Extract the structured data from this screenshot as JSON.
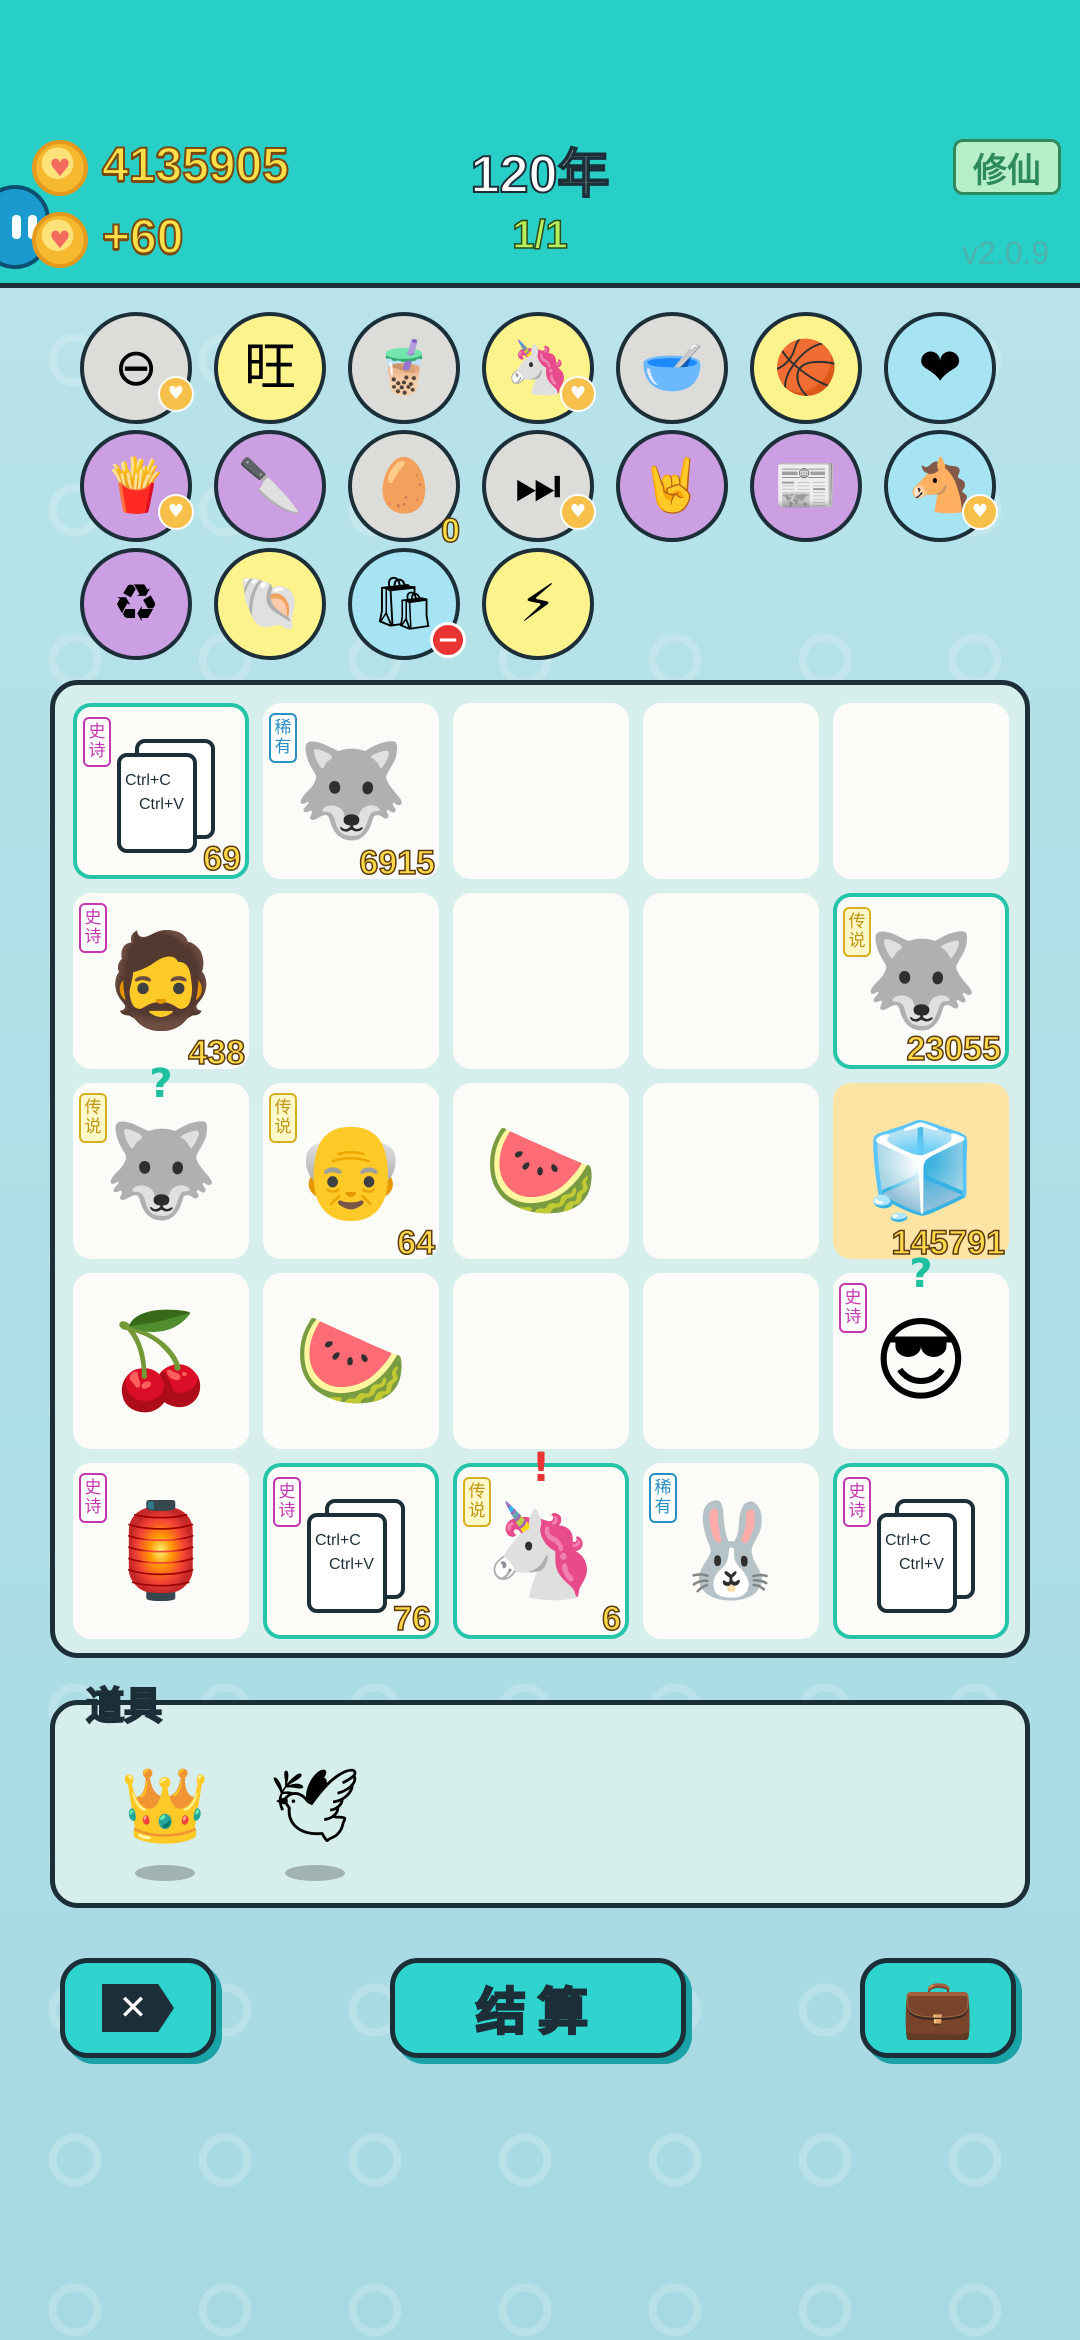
{
  "header": {
    "coins": "4135905",
    "income": "+60",
    "year": "120年",
    "progress": "1/1",
    "xiuxian_label": "修仙",
    "version": "v2.0.9"
  },
  "items": [
    {
      "icon": "no-entry-icon",
      "glyph": "⊖",
      "badge": "heart"
    },
    {
      "icon": "wang-dice-icon",
      "glyph": "旺",
      "badge": ""
    },
    {
      "icon": "bubble-tea-icon",
      "glyph": "🧋",
      "badge": ""
    },
    {
      "icon": "unicorn-icon",
      "glyph": "🦄",
      "badge": "heart"
    },
    {
      "icon": "dog-bowl-icon",
      "glyph": "🥣",
      "badge": ""
    },
    {
      "icon": "basketballs-icon",
      "glyph": "🏀",
      "badge": ""
    },
    {
      "icon": "heart-blood-bag-icon",
      "glyph": "❤",
      "badge": ""
    },
    {
      "icon": "french-fries-icon",
      "glyph": "🍟",
      "badge": "heart"
    },
    {
      "icon": "cleaver-icon",
      "glyph": "🔪",
      "badge": ""
    },
    {
      "icon": "egg-tray-icon",
      "glyph": "🥚",
      "badge": "",
      "count": "0"
    },
    {
      "icon": "skip-icon",
      "glyph": "⏭",
      "badge": "heart"
    },
    {
      "icon": "rock-hand-icon",
      "glyph": "🤘",
      "badge": ""
    },
    {
      "icon": "time-magazine-icon",
      "glyph": "📰",
      "badge": ""
    },
    {
      "icon": "twin-unicorns-icon",
      "glyph": "🐴",
      "badge": "heart"
    },
    {
      "icon": "recycle-icon",
      "glyph": "♻",
      "badge": ""
    },
    {
      "icon": "shell-icon",
      "glyph": "🐚",
      "badge": ""
    },
    {
      "icon": "trash-bag-icon",
      "glyph": "🛍",
      "badge": "remove"
    },
    {
      "icon": "lightning-icon",
      "glyph": "⚡",
      "badge": ""
    }
  ],
  "board": [
    {
      "name": "copy-paste-card",
      "glyph": "",
      "card": true,
      "card_text1": "Ctrl+C",
      "card_text2": "Ctrl+V",
      "rarity": "史诗",
      "rclass": "epic",
      "count": "69",
      "hl": true
    },
    {
      "name": "husky",
      "glyph": "🐺",
      "rarity": "稀有",
      "rclass": "rare",
      "count": "6915"
    },
    {
      "name": "empty",
      "glyph": ""
    },
    {
      "name": "empty",
      "glyph": ""
    },
    {
      "name": "empty",
      "glyph": ""
    },
    {
      "name": "bearded-old-man",
      "glyph": "🧔",
      "rarity": "史诗",
      "rclass": "epic",
      "count": "438"
    },
    {
      "name": "empty",
      "glyph": ""
    },
    {
      "name": "empty",
      "glyph": ""
    },
    {
      "name": "empty",
      "glyph": ""
    },
    {
      "name": "crowned-husky",
      "glyph": "🐺",
      "rarity": "传说",
      "rclass": "legend",
      "count": "23055",
      "hl": true
    },
    {
      "name": "crowned-husky",
      "glyph": "🐺",
      "rarity": "传说",
      "rclass": "legend",
      "mark": "?"
    },
    {
      "name": "rich-grandpa",
      "glyph": "👴",
      "rarity": "传说",
      "rclass": "legend",
      "count": "64"
    },
    {
      "name": "watermelon",
      "glyph": "🍉"
    },
    {
      "name": "empty",
      "glyph": ""
    },
    {
      "name": "fridge",
      "glyph": "🧊",
      "count": "145791",
      "gold": true
    },
    {
      "name": "cherries",
      "glyph": "🍒"
    },
    {
      "name": "watermelon",
      "glyph": "🍉"
    },
    {
      "name": "empty",
      "glyph": ""
    },
    {
      "name": "empty",
      "glyph": ""
    },
    {
      "name": "sunglasses-man",
      "glyph": "😎",
      "rarity": "史诗",
      "rclass": "epic",
      "mark": "?"
    },
    {
      "name": "rabbit-house",
      "glyph": "🏮",
      "rarity": "史诗",
      "rclass": "epic"
    },
    {
      "name": "copy-paste-card",
      "glyph": "",
      "card": true,
      "card_text1": "Ctrl+C",
      "card_text2": "Ctrl+V",
      "rarity": "史诗",
      "rclass": "epic",
      "count": "76",
      "hl": true
    },
    {
      "name": "unicorn",
      "glyph": "🦄",
      "rarity": "传说",
      "rclass": "legend",
      "count": "6",
      "hl": true,
      "mark": "!"
    },
    {
      "name": "rabbit",
      "glyph": "🐰",
      "rarity": "稀有",
      "rclass": "rare"
    },
    {
      "name": "copy-paste-card",
      "glyph": "",
      "card": true,
      "card_text1": "Ctrl+C",
      "card_text2": "Ctrl+V",
      "rarity": "史诗",
      "rclass": "epic",
      "hl": true
    }
  ],
  "props": {
    "label": "道具",
    "items": [
      {
        "name": "crown-icon",
        "glyph": "👑"
      },
      {
        "name": "dove-icon",
        "glyph": "🕊"
      }
    ]
  },
  "buttons": {
    "close_glyph": "✕",
    "settle_label": "结算",
    "bag_glyph": "💼"
  }
}
